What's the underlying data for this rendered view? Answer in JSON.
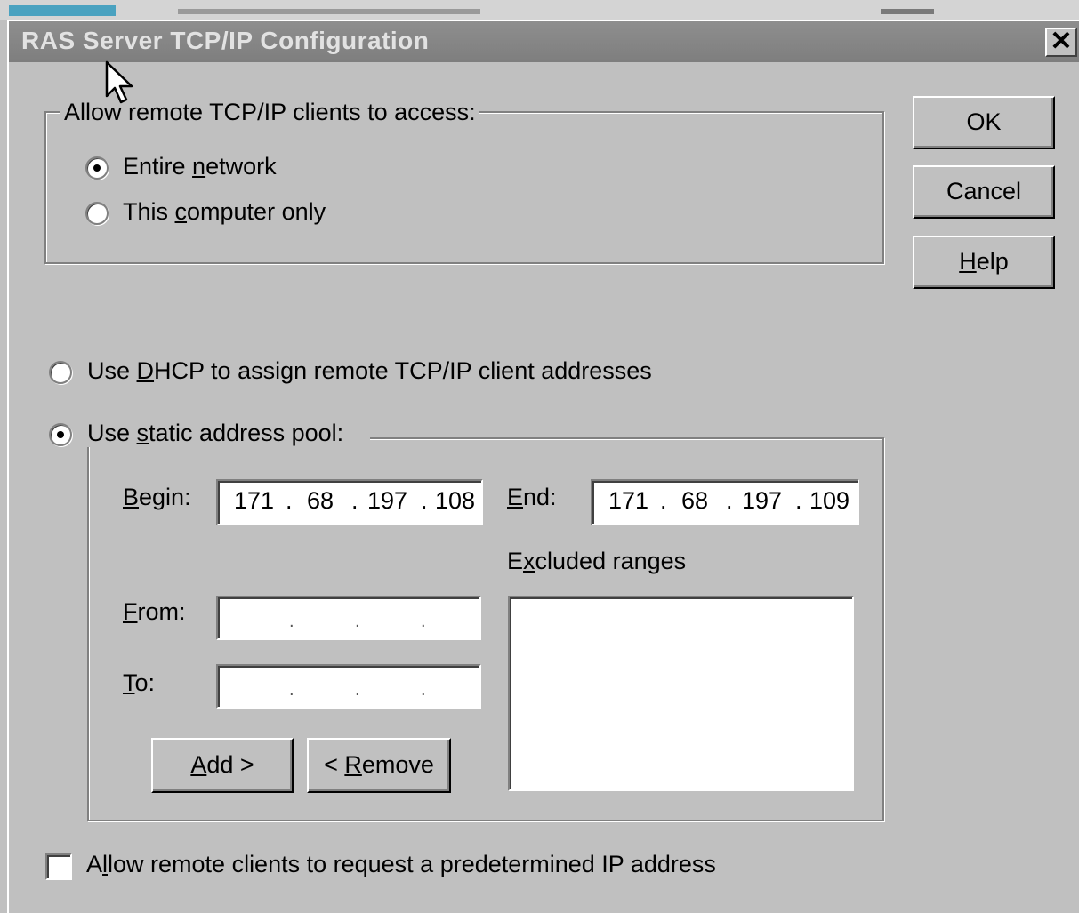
{
  "dialog": {
    "title": "RAS Server TCP/IP Configuration",
    "close_label": "✕"
  },
  "access": {
    "legend": "Allow remote TCP/IP clients to access:",
    "entire_network": {
      "pre": "Entire ",
      "ul": "n",
      "post": "etwork",
      "selected": true
    },
    "this_computer": {
      "pre": "This ",
      "ul": "c",
      "post": "omputer only",
      "selected": false
    }
  },
  "buttons": {
    "ok": "OK",
    "cancel": "Cancel",
    "help": {
      "ul": "H",
      "post": "elp"
    }
  },
  "dhcp": {
    "pre": "Use ",
    "ul": "D",
    "post": "HCP to assign remote TCP/IP client addresses",
    "selected": false
  },
  "static_pool": {
    "pre": "Use ",
    "ul": "s",
    "post": "tatic address pool:",
    "selected": true,
    "begin": {
      "ul": "B",
      "post": "egin:",
      "octets": [
        "171",
        "68",
        "197",
        "108"
      ]
    },
    "end": {
      "ul": "E",
      "post": "nd:",
      "octets": [
        "171",
        "68",
        "197",
        "109"
      ]
    },
    "excluded": {
      "pre": "E",
      "ul": "x",
      "post": "cluded ranges"
    },
    "from": {
      "ul": "F",
      "post": "rom:"
    },
    "to": {
      "ul": "T",
      "post": "o:"
    },
    "add": {
      "ul": "A",
      "post": "dd >"
    },
    "remove": {
      "pre": "< ",
      "ul": "R",
      "post": "emove"
    }
  },
  "predetermined": {
    "pre": "A",
    "ul": "l",
    "post": "low remote clients to request a predetermined IP address",
    "checked": false
  }
}
